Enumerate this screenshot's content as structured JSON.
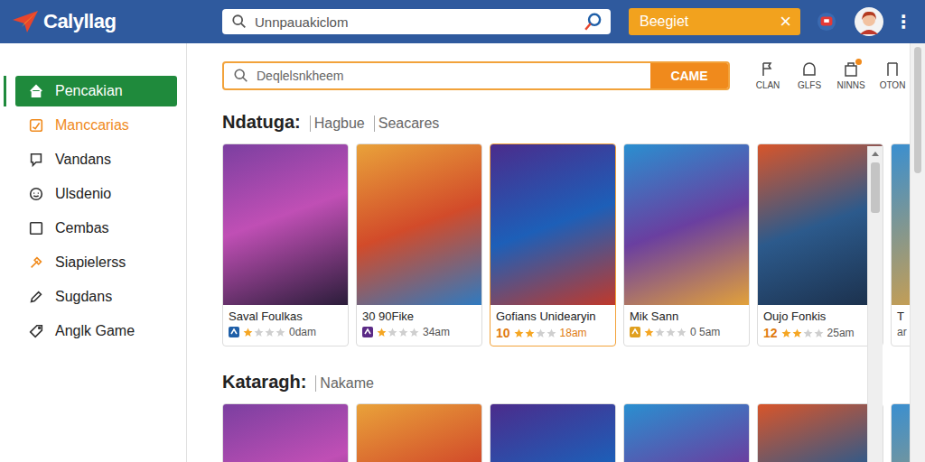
{
  "header": {
    "logo": "Calyllag",
    "search": {
      "placeholder": "Unnpauakiclom"
    },
    "button": {
      "label": "Beegiet",
      "close": "×"
    },
    "menu": "⋮"
  },
  "sidebar": {
    "items": [
      {
        "label": "Pencakian",
        "selected": true,
        "emphasis": false,
        "color": "#ffffff"
      },
      {
        "label": "Manccarias",
        "selected": false,
        "emphasis": true,
        "color": "#f08a1c"
      },
      {
        "label": "Vandans",
        "selected": false,
        "emphasis": false,
        "color": "#333333"
      },
      {
        "label": "Ulsdenio",
        "selected": false,
        "emphasis": false,
        "color": "#333333"
      },
      {
        "label": "Cembas",
        "selected": false,
        "emphasis": false,
        "color": "#333333"
      },
      {
        "label": "Siapielerss",
        "selected": false,
        "emphasis": false,
        "color": "#f08a1c"
      },
      {
        "label": "Sugdans",
        "selected": false,
        "emphasis": false,
        "color": "#333333"
      },
      {
        "label": "Anglk Game",
        "selected": false,
        "emphasis": false,
        "color": "#333333"
      }
    ]
  },
  "search": {
    "placeholder": "Deqlelsnkheem",
    "button": "CAME"
  },
  "tools": [
    {
      "label": "CLAN",
      "dot": false
    },
    {
      "label": "GLFS",
      "dot": false
    },
    {
      "label": "NINNS",
      "dot": true
    },
    {
      "label": "OTON",
      "dot": false
    }
  ],
  "sections": [
    {
      "title": "Ndatuga:",
      "tabs": [
        {
          "label": "Hagbue",
          "selected": false
        },
        {
          "label": "Seacares",
          "selected": false
        }
      ],
      "cards": [
        {
          "title": "Saval Foulkas",
          "selected": false,
          "rating": {
            "badge": {
              "kind": "icon",
              "color": "#1f5fa8"
            },
            "stars": 1,
            "time": "0dam"
          }
        },
        {
          "title": "30 90Fike",
          "selected": false,
          "rating": {
            "badge": {
              "kind": "icon",
              "color": "#5b2a86"
            },
            "stars": 1,
            "time": "34am"
          }
        },
        {
          "title": "Gofians Unidearyin",
          "selected": true,
          "rating": {
            "badge": {
              "kind": "number",
              "text": "10"
            },
            "stars": 2,
            "time": "18am"
          }
        },
        {
          "title": "Mik Sann",
          "selected": false,
          "rating": {
            "badge": {
              "kind": "icon",
              "color": "#e0a020"
            },
            "stars": 1,
            "time": "0 5am"
          }
        },
        {
          "title": "Oujo Fonkis",
          "selected": false,
          "rating": {
            "badge": {
              "kind": "number",
              "text": "12"
            },
            "stars": 2,
            "time": "25am"
          }
        },
        {
          "title": "T",
          "selected": false,
          "rating": {
            "time": "ar"
          }
        }
      ]
    },
    {
      "title": "Kataragh:",
      "tabs": [
        {
          "label": "Nakame",
          "selected": false
        }
      ],
      "cards": [
        {
          "selected": false
        },
        {
          "selected": false
        },
        {
          "selected": false
        },
        {
          "selected": false
        },
        {
          "selected": false
        },
        {
          "selected": false
        }
      ]
    }
  ]
}
